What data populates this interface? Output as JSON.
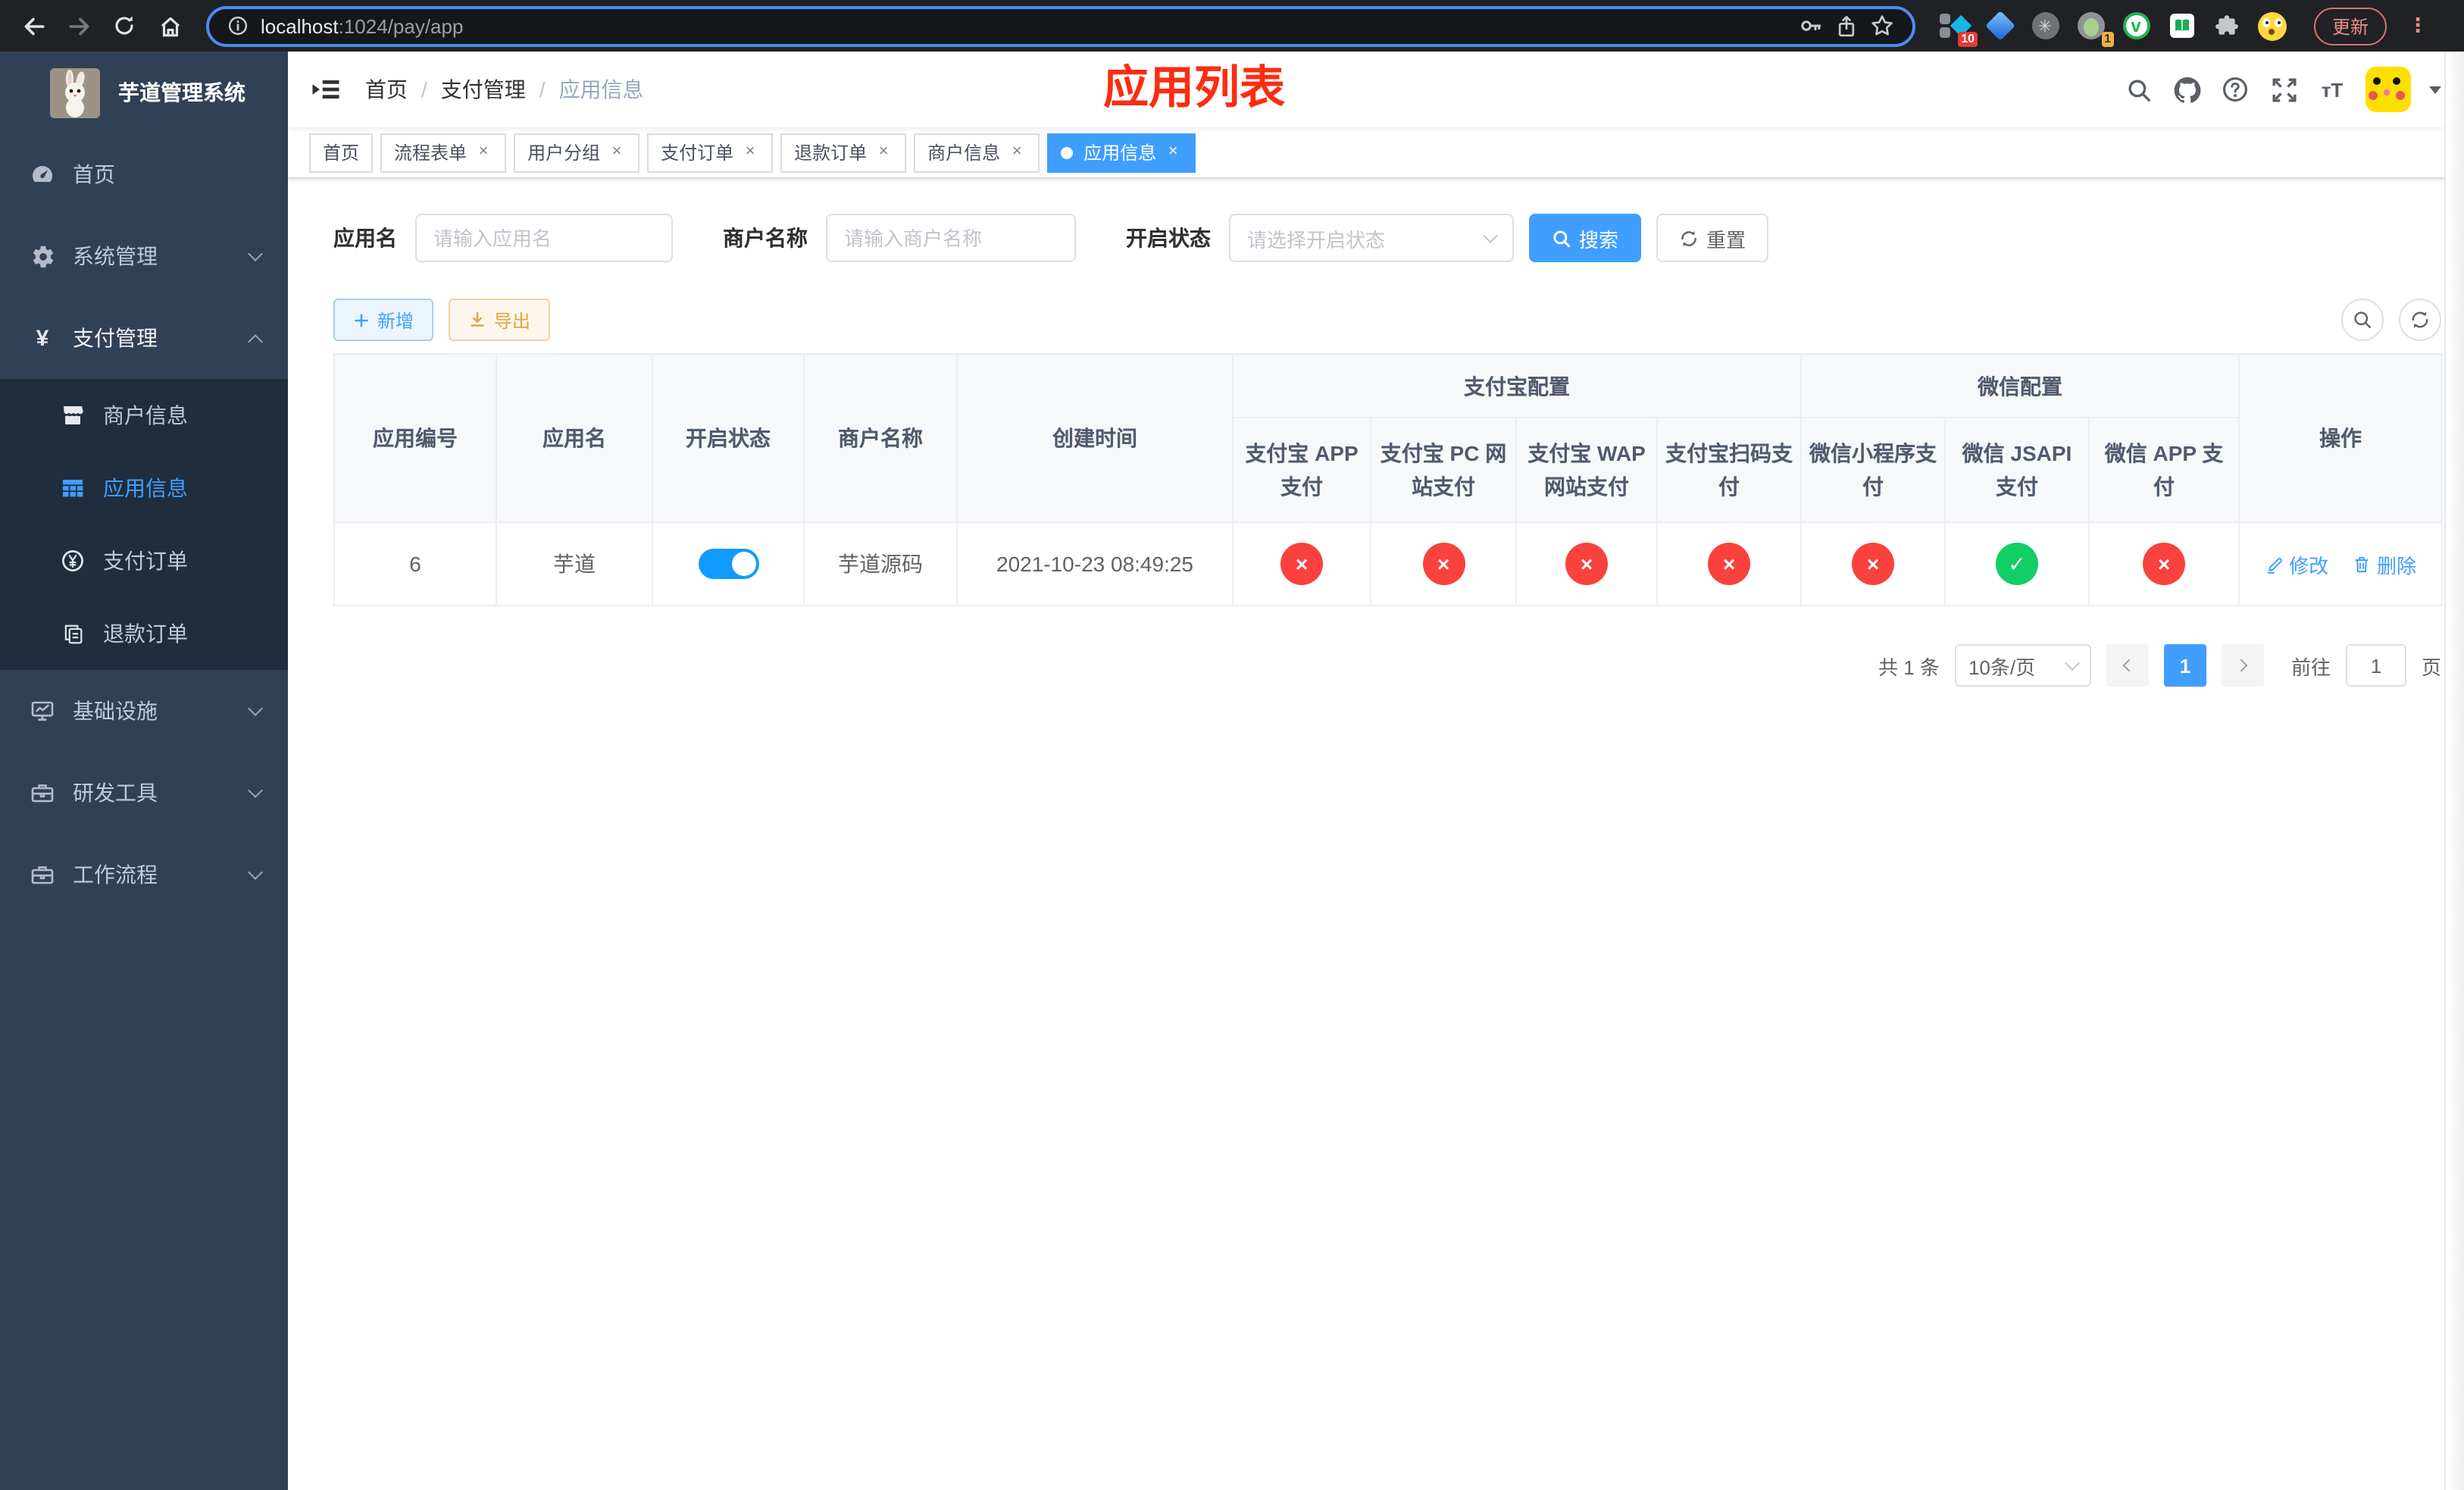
{
  "colors": {
    "primary": "#409eff",
    "success": "#12ce66",
    "danger": "#f9423d",
    "warning": "#e6a23c",
    "sidebar_bg": "#304156",
    "submenu_bg": "#1f2d3d",
    "annotation_red": "#fe2c10"
  },
  "browser": {
    "url_host": "localhost",
    "url_path": ":1024/pay/app",
    "update_button": "更新",
    "ext_badge_a": "10",
    "ext_badge_b": "1"
  },
  "sidebar": {
    "title": "芋道管理系统",
    "menu": [
      "首页",
      "系统管理",
      "支付管理",
      "商户信息",
      "应用信息",
      "支付订单",
      "退款订单",
      "基础设施",
      "研发工具",
      "工作流程"
    ]
  },
  "navbar": {
    "breadcrumb": [
      "首页",
      "支付管理",
      "应用信息"
    ]
  },
  "annotation": "应用列表",
  "tabs": [
    "首页",
    "流程表单",
    "用户分组",
    "支付订单",
    "退款订单",
    "商户信息",
    "应用信息"
  ],
  "filter": {
    "app_name_label": "应用名",
    "app_name_placeholder": "请输入应用名",
    "merchant_label": "商户名称",
    "merchant_placeholder": "请输入商户名称",
    "status_label": "开启状态",
    "status_placeholder": "请选择开启状态",
    "search_button": "搜索",
    "reset_button": "重置"
  },
  "toolbar": {
    "add_button": "新增",
    "export_button": "导出"
  },
  "table": {
    "groups": {
      "alipay": "支付宝配置",
      "wechat": "微信配置"
    },
    "columns": [
      "应用编号",
      "应用名",
      "开启状态",
      "商户名称",
      "创建时间",
      "支付宝 APP 支付",
      "支付宝 PC 网站支付",
      "支付宝 WAP 网站支付",
      "支付宝扫码支付",
      "微信小程序支付",
      "微信 JSAPI 支付",
      "微信 APP 支付",
      "操作"
    ],
    "row": {
      "id": "6",
      "name": "芋道",
      "enabled": true,
      "merchant": "芋道源码",
      "created_at": "2021-10-23 08:49:25",
      "statuses": [
        false,
        false,
        false,
        false,
        false,
        true,
        false
      ],
      "edit": "修改",
      "delete": "删除"
    }
  },
  "pagination": {
    "total": "共 1 条",
    "page_size": "10条/页",
    "page": "1",
    "goto": "前往",
    "unit": "页",
    "goto_value": "1"
  }
}
